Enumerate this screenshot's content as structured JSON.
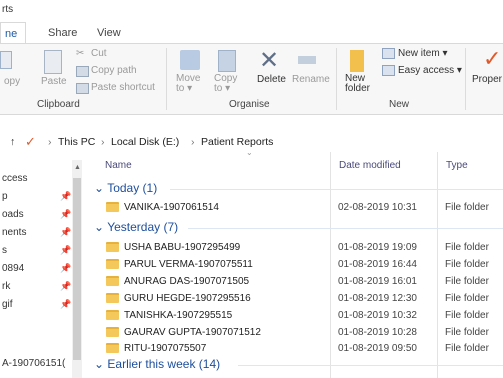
{
  "window": {
    "title": "rts"
  },
  "tabs": {
    "home": "ne",
    "share": "Share",
    "view": "View"
  },
  "ribbon": {
    "copy": "opy",
    "paste": "Paste",
    "cut": "Cut",
    "copy_path": "Copy path",
    "paste_shortcut": "Paste shortcut",
    "clipboard": "Clipboard",
    "move_to": "Move\nto ▾",
    "copy_to": "Copy\nto ▾",
    "delete": "Delete",
    "rename": "Rename",
    "organise": "Organise",
    "new_folder": "New\nfolder",
    "new_item": "New item ▾",
    "easy_access": "Easy access ▾",
    "new": "New",
    "properties": "Proper"
  },
  "address": {
    "back": "↑",
    "this_pc": "This PC",
    "local_disk": "Local Disk (E:)",
    "folder": "Patient Reports"
  },
  "nav": {
    "items": [
      "ccess",
      "p",
      "oads",
      "nents",
      "s",
      "0894",
      "rk",
      "gif",
      "A-190706151("
    ]
  },
  "columns": {
    "name": "Name",
    "date": "Date modified",
    "type": "Type"
  },
  "groups": [
    {
      "label": "Today (1)",
      "rows": [
        {
          "name": "VANIKA-1907061514",
          "date": "02-08-2019 10:31",
          "type": "File folder"
        }
      ]
    },
    {
      "label": "Yesterday (7)",
      "rows": [
        {
          "name": "USHA BABU-1907295499",
          "date": "01-08-2019 19:09",
          "type": "File folder"
        },
        {
          "name": "PARUL VERMA-1907075511",
          "date": "01-08-2019 16:44",
          "type": "File folder"
        },
        {
          "name": "ANURAG DAS-1907071505",
          "date": "01-08-2019 16:01",
          "type": "File folder"
        },
        {
          "name": "GURU HEGDE-1907295516",
          "date": "01-08-2019 12:30",
          "type": "File folder"
        },
        {
          "name": "TANISHKA-1907295515",
          "date": "01-08-2019 10:32",
          "type": "File folder"
        },
        {
          "name": "GAURAV GUPTA-1907071512",
          "date": "01-08-2019 10:28",
          "type": "File folder"
        },
        {
          "name": "RITU-1907075507",
          "date": "01-08-2019 09:50",
          "type": "File folder"
        }
      ]
    },
    {
      "label": "Earlier this week (14)",
      "rows": []
    }
  ],
  "colors": {
    "accent": "#1e4f9c",
    "folder": "#f4c85a",
    "check": "#e05a2b"
  }
}
